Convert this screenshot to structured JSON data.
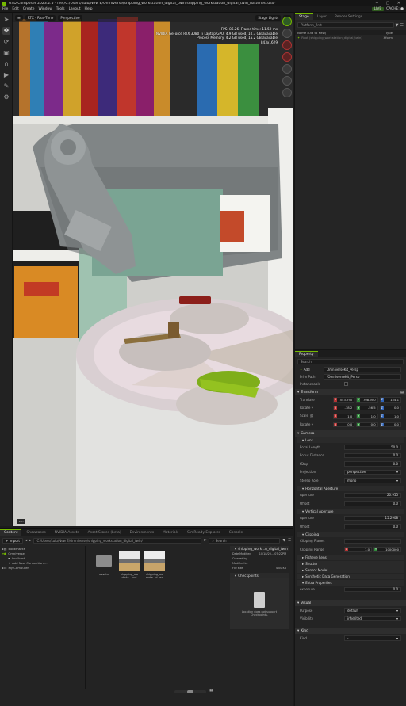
{
  "window": {
    "title": "USD Composer  2023.2.5  -  file:/C:/Users/kulu/New E/Omniverse/shipping_workstation_digital_twin/shipping_workstation_digital_twin_flattened.usd*",
    "live": "LIVE",
    "cache": "CACHE: ●"
  },
  "menu": [
    "File",
    "Edit",
    "Create",
    "Window",
    "Tools",
    "Layout",
    "Help"
  ],
  "viewport": {
    "renderer": "RTX - Real-Time",
    "camera": "Perspective",
    "stage_lights": "Stage Lights",
    "stats": [
      "FPS: 86.26, Frame time: 11.59 ms",
      "NVIDIA GeForce RTX 3080 Ti Laptop GPU: 4.9 GB used, 10.7 GB available",
      "Process Memory: 4.2 GB used, 15.2 GB available",
      "843x1629"
    ],
    "badge": "cm"
  },
  "stage": {
    "tabs": [
      "Stage",
      "Layer",
      "Render Settings"
    ],
    "search_value": "Platform_first",
    "columns": {
      "name": "Name (Old to New)",
      "type": "Type"
    },
    "rows": [
      {
        "name": "Root (shipping_workstation_digital_twin)",
        "type": "Xform"
      }
    ]
  },
  "property": {
    "tab": "Property",
    "search_placeholder": "Search",
    "add_label": "Add",
    "prim_name": "OmniverseKit_Persp",
    "prim_path_label": "Prim Path",
    "prim_path": "/OmniverseKit_Persp",
    "instanceable_label": "Instanceable",
    "transform": {
      "title": "Transform",
      "translate_label": "Translate",
      "translate": [
        "553.790",
        "708.900",
        "154.1"
      ],
      "rotate_label": "Rotate ▾",
      "rotate": [
        "-18.2",
        "-56.5",
        "0.0"
      ],
      "scale_label": "Scale ⛓",
      "scale": [
        "1.0",
        "1.0",
        "1.0"
      ],
      "rotate2_label": "Rotate ▾",
      "rotate2": [
        "0.0",
        "0.0",
        "0.0"
      ]
    },
    "camera": {
      "title": "Camera",
      "lens": {
        "title": "Lens",
        "rows": [
          {
            "label": "Focal Length",
            "value": "50.0"
          },
          {
            "label": "Focus Distance",
            "value": "0.0"
          },
          {
            "label": "fStop",
            "value": "0.0"
          },
          {
            "label": "Projection",
            "value": "perspective"
          },
          {
            "label": "Stereo Role",
            "value": "mono"
          }
        ]
      },
      "horizontal": {
        "title": "Horizontal Aperture",
        "rows": [
          {
            "label": "Aperture",
            "value": "20.955"
          },
          {
            "label": "Offset",
            "value": "0.0"
          }
        ]
      },
      "vertical": {
        "title": "Vertical Aperture",
        "rows": [
          {
            "label": "Aperture",
            "value": "15.2908"
          },
          {
            "label": "Offset",
            "value": "0.0"
          }
        ]
      },
      "clipping": {
        "title": "Clipping",
        "planes_label": "Clipping Planes",
        "range_label": "Clipping Range",
        "range": [
          "1.0",
          "1000000"
        ]
      },
      "collapsed": [
        "Fisheye Lens",
        "Shutter",
        "Sensor Model",
        "Synthetic Data Generation"
      ],
      "extra": {
        "title": "Extra Properties",
        "label": "exposure",
        "value": "0.0"
      }
    },
    "visual": {
      "title": "Visual",
      "rows": [
        {
          "label": "Purpose",
          "value": "default"
        },
        {
          "label": "Visibility",
          "value": "inherited"
        }
      ]
    },
    "kind": {
      "title": "Kind",
      "label": "Kind",
      "value": "-"
    }
  },
  "content": {
    "tabs": [
      "Content",
      "Showcases",
      "NVIDIA Assets",
      "Asset Stores (beta)",
      "Environments",
      "Materials",
      "SimReady Explorer",
      "Console"
    ],
    "import_label": "+ Import",
    "path": "C:/Users/kulu/New E/Omniverse/shipping_workstation_digital_twin/",
    "search_placeholder": "Search",
    "tree": [
      "Bookmarks",
      "Omniverse",
      "localhost",
      "Add New Connection ...",
      "My Computer"
    ],
    "files": [
      {
        "name": "assets",
        "kind": "folder"
      },
      {
        "name": "shipping_wo rksta...usd",
        "kind": "scene"
      },
      {
        "name": "shipping_wo rksta...d.usd",
        "kind": "scene"
      }
    ],
    "details": {
      "title": "shipping_work...n_digital_twin",
      "rows": [
        {
          "label": "Date Modified",
          "value": "10/18/20... 07:22PM"
        },
        {
          "label": "Created by",
          "value": ""
        },
        {
          "label": "Modified by",
          "value": ""
        },
        {
          "label": "File size",
          "value": "4.00 KB"
        }
      ],
      "checkpoints": "Checkpoints",
      "no_checkpoints": "Location does not support Checkpoints."
    }
  },
  "colors": {
    "accent": "#76b900",
    "panel": "#242424",
    "selection": "#2e3f54"
  }
}
